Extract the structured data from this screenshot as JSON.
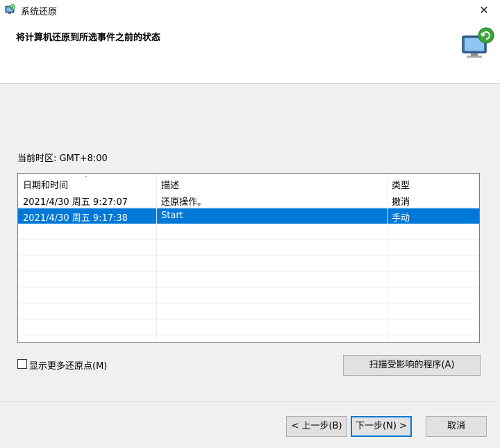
{
  "window": {
    "title": "系统还原",
    "close_glyph": "✕"
  },
  "header": {
    "heading": "将计算机还原到所选事件之前的状态"
  },
  "timezone": {
    "text": "当前时区: GMT+8:00"
  },
  "table": {
    "columns": [
      "日期和时间",
      "描述",
      "类型"
    ],
    "rows": [
      {
        "date": "2021/4/30 周五 9:27:07",
        "description": "还原操作。",
        "type": "撤消",
        "selected": false
      },
      {
        "date": "2021/4/30 周五 9:17:38",
        "description": "Start",
        "type": "手动",
        "selected": true
      }
    ]
  },
  "options": {
    "show_more_label": "显示更多还原点(M)",
    "show_more_checked": false
  },
  "buttons": {
    "scan": "扫描受影响的程序(A)",
    "back": "< 上一步(B)",
    "next": "下一步(N) >",
    "cancel": "取消"
  },
  "icons": {
    "titlebar": "system-restore-icon",
    "hero": "system-restore-monitor-icon",
    "sort": "sort-chevron-icon"
  },
  "colors": {
    "selection": "#0078d7",
    "focus_border": "#0078d7"
  }
}
